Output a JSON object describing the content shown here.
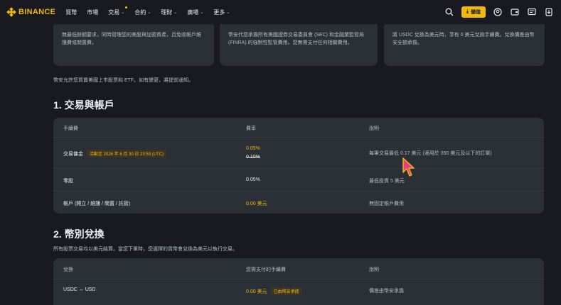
{
  "header": {
    "brand": "BINANCE",
    "nav": [
      {
        "label": "買幣",
        "chevron": false
      },
      {
        "label": "市場",
        "chevron": false
      },
      {
        "label": "交易",
        "chevron": true,
        "dot": true
      },
      {
        "label": "合約",
        "chevron": true
      },
      {
        "label": "理財",
        "chevron": true
      },
      {
        "label": "廣場",
        "chevron": true
      },
      {
        "label": "更多",
        "chevron": true
      }
    ],
    "deposit_label": "儲值",
    "icons": [
      "search-icon",
      "user-icon",
      "wallet-icon",
      "message-icon",
      "download-icon"
    ]
  },
  "cards": [
    {
      "text": "無最低餘額要求，同時管理您的美股與加密資產，且免收帳戶維護費或閒置費。"
    },
    {
      "text": "幣安代您承擔所有美國證券交易委員會 (SEC) 和金融業監管局 (FINRA) 的強制性監管費用。您無需支付任何相關費用。"
    },
    {
      "text": "將 USDC 兌換為美元時，享有 0 美元兌換手續費。兌換價差由幣安全額承擔。"
    }
  ],
  "note": "幣安允許您買賣美國上市股票和 ETF。如有變更，將提前通知。",
  "section1": {
    "title": "1. 交易與帳戶",
    "headers": [
      "手續費",
      "費率",
      "說明"
    ],
    "rows": [
      {
        "name": "交易傭金",
        "tag": "活動至 2026 年 6 月 30 日 23:59 (UTC)",
        "rate": "0.05%",
        "old_rate": "0.10%",
        "desc": "每筆交易最低 0.17 美元 (適用於 350 美元及以下的訂單)"
      },
      {
        "name": "零股",
        "rate": "0.05%",
        "desc": "最低投資 5 美元"
      },
      {
        "name": "帳戶 (開立 / 維護 / 閒置 / 託管)",
        "rate": "0.00 美元",
        "desc": "無固定帳戶費用"
      }
    ]
  },
  "section2": {
    "title": "2. 幣別兌換",
    "subtitle": "所有股票交易均以美元結算。當您下單時，您選擇的貨幣會兌換為美元以執行交易。",
    "headers": [
      "兌換",
      "您需支付的手續費",
      "說明"
    ],
    "rows": [
      {
        "name": "USDC ↔ USD",
        "rate": "0.00 美元",
        "tag": "已由幣安承擔",
        "desc": "價差由幣安承擔"
      }
    ]
  },
  "colors": {
    "accent": "#f0b90b",
    "background": "#181a20",
    "card": "#2b2f36"
  }
}
